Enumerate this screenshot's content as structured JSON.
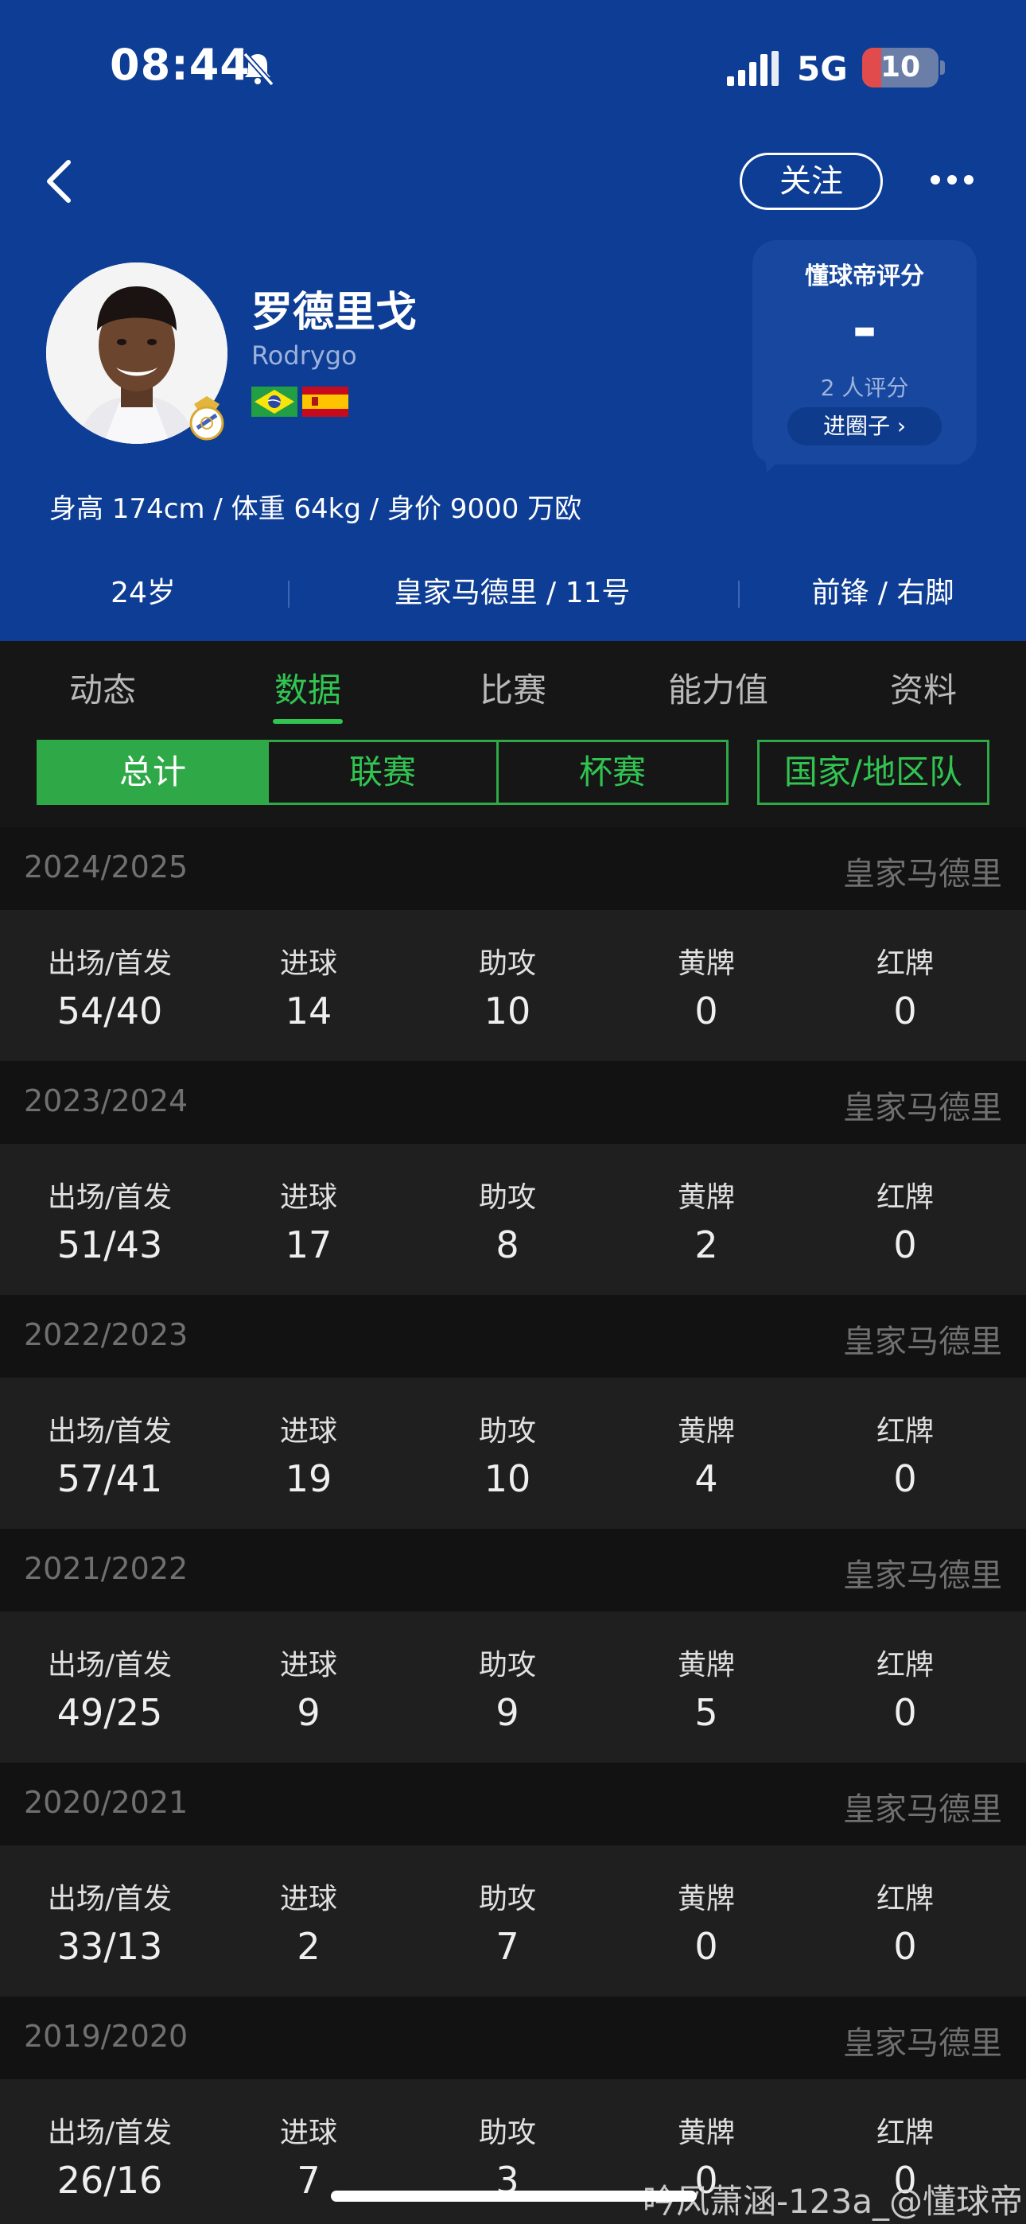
{
  "status_bar": {
    "time": "08:44",
    "network": "5G",
    "battery": "10",
    "battery_fraction": 0.25
  },
  "header": {
    "follow_label": "关注"
  },
  "player": {
    "name": "罗德里戈",
    "name_en": "Rodrygo",
    "nationalities": [
      "Brazil",
      "Spain"
    ],
    "body_line": "身高 174cm / 体重 64kg / 身价 9000 万欧",
    "age": "24岁",
    "club_number": "皇家马德里 / 11号",
    "position_foot": "前锋 / 右脚"
  },
  "rating": {
    "title": "懂球帝评分",
    "value": "-",
    "count": "2 人评分",
    "button": "进圈子 ›"
  },
  "tabs": [
    {
      "label": "动态",
      "active": false
    },
    {
      "label": "数据",
      "active": true
    },
    {
      "label": "比赛",
      "active": false
    },
    {
      "label": "能力值",
      "active": false
    },
    {
      "label": "资料",
      "active": false
    }
  ],
  "filters": [
    {
      "label": "总计",
      "active": true
    },
    {
      "label": "联赛",
      "active": false
    },
    {
      "label": "杯赛",
      "active": false
    },
    {
      "label": "国家/地区队",
      "active": false
    }
  ],
  "stat_labels": [
    "出场/首发",
    "进球",
    "助攻",
    "黄牌",
    "红牌"
  ],
  "seasons": [
    {
      "year": "2024/2025",
      "club": "皇家马德里",
      "values": [
        "54/40",
        "14",
        "10",
        "0",
        "0"
      ]
    },
    {
      "year": "2023/2024",
      "club": "皇家马德里",
      "values": [
        "51/43",
        "17",
        "8",
        "2",
        "0"
      ]
    },
    {
      "year": "2022/2023",
      "club": "皇家马德里",
      "values": [
        "57/41",
        "19",
        "10",
        "4",
        "0"
      ]
    },
    {
      "year": "2021/2022",
      "club": "皇家马德里",
      "values": [
        "49/25",
        "9",
        "9",
        "5",
        "0"
      ]
    },
    {
      "year": "2020/2021",
      "club": "皇家马德里",
      "values": [
        "33/13",
        "2",
        "7",
        "0",
        "0"
      ]
    },
    {
      "year": "2019/2020",
      "club": "皇家马德里",
      "values": [
        "26/16",
        "7",
        "3",
        "0",
        "0"
      ]
    }
  ],
  "watermark": "吟风萧涵-123a_@懂球帝",
  "colors": {
    "header_bg": "#0d3d94",
    "accent_green": "#31c451",
    "page_bg": "#161616"
  }
}
